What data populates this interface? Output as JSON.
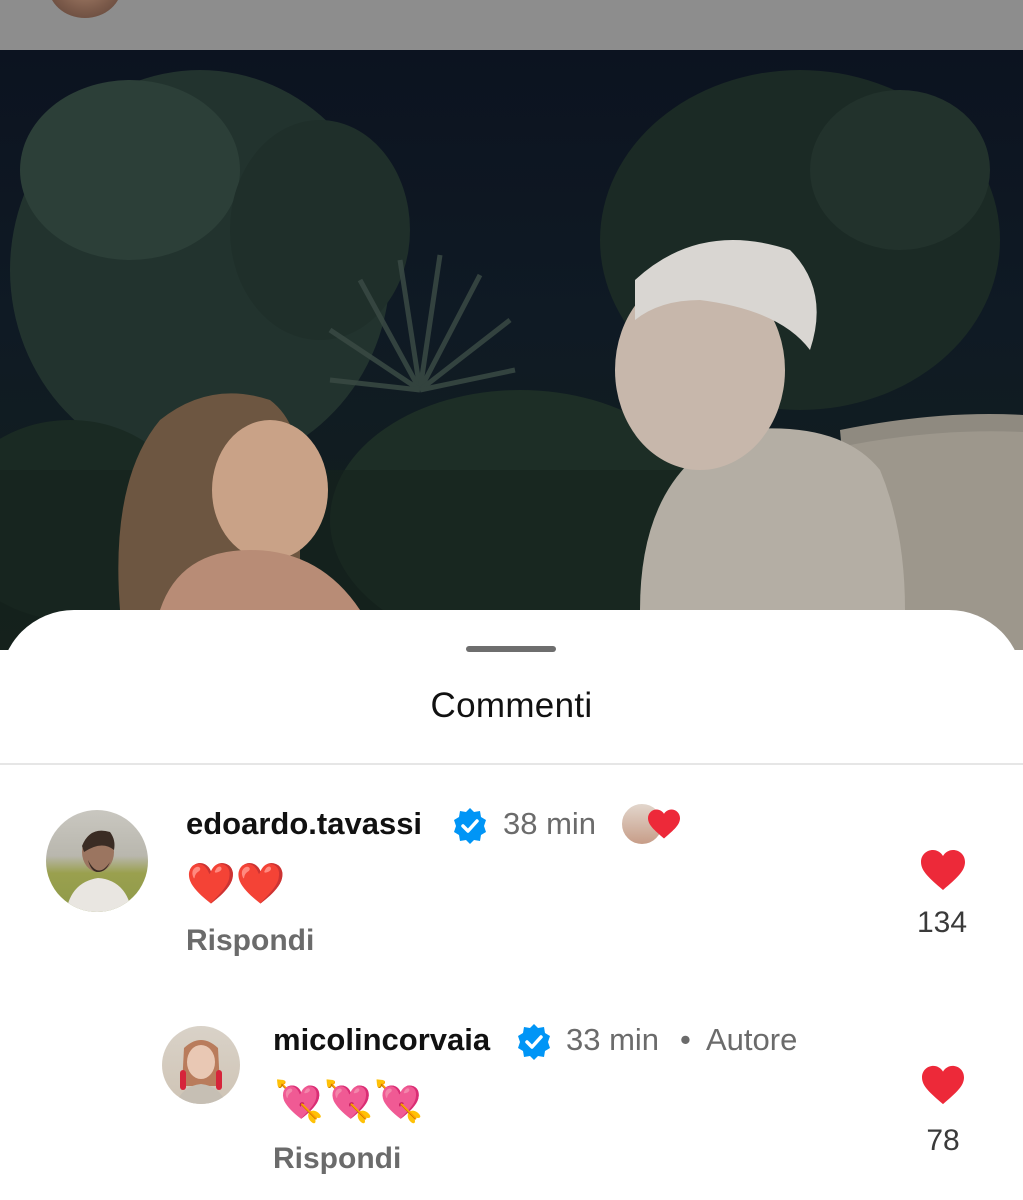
{
  "sheet": {
    "title": "Commenti"
  },
  "colors": {
    "like_red": "#ED2939",
    "verified_blue": "#0095F6",
    "muted_text": "#6B6B6B"
  },
  "comments": [
    {
      "username": "edoardo.tavassi",
      "verified": true,
      "time": "38 min",
      "liked_by_author": true,
      "text": "❤️❤️",
      "reply_label": "Rispondi",
      "like_icon": "heart-icon",
      "like_count": "134"
    },
    {
      "username": "micolincorvaia",
      "verified": true,
      "time": "33 min",
      "separator": "•",
      "author_label": "Autore",
      "text": "💘💘💘",
      "reply_label": "Rispondi",
      "like_icon": "heart-icon",
      "like_count": "78"
    }
  ]
}
